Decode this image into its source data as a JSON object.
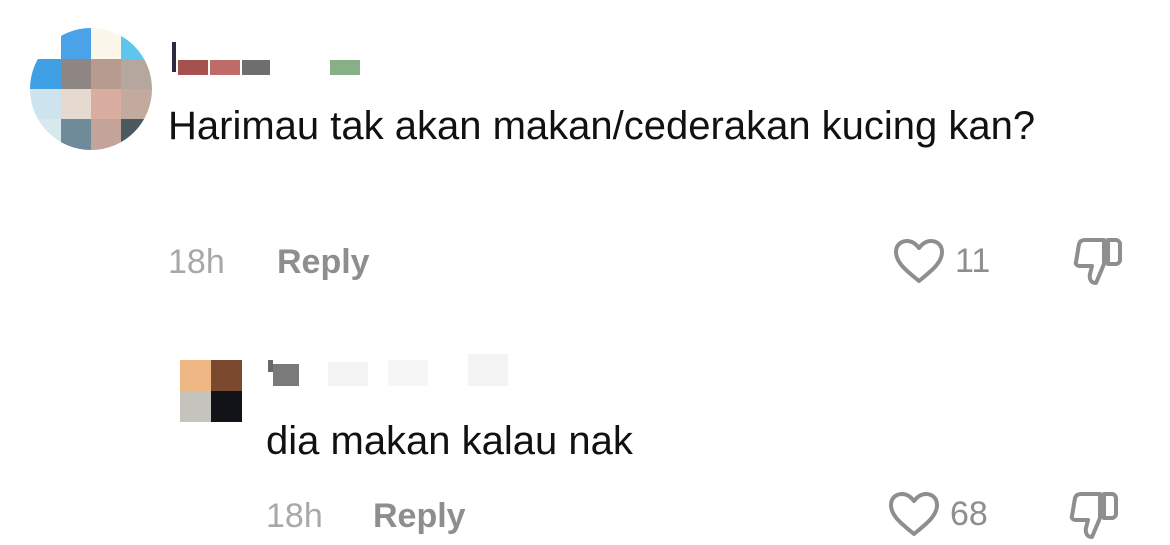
{
  "comments": [
    {
      "text": "Harimau tak akan makan/cederakan kucing kan?",
      "time": "18h",
      "reply_label": "Reply",
      "like_count": "11",
      "icons": {
        "like": "heart-outline-icon",
        "dislike": "thumbs-down-icon"
      }
    },
    {
      "text": "dia makan kalau nak",
      "time": "18h",
      "reply_label": "Reply",
      "like_count": "68",
      "icons": {
        "like": "heart-outline-icon",
        "dislike": "thumbs-down-icon"
      }
    }
  ],
  "colors": {
    "text": "#111111",
    "muted": "#8e8e8e",
    "time": "#a8a8a8"
  }
}
